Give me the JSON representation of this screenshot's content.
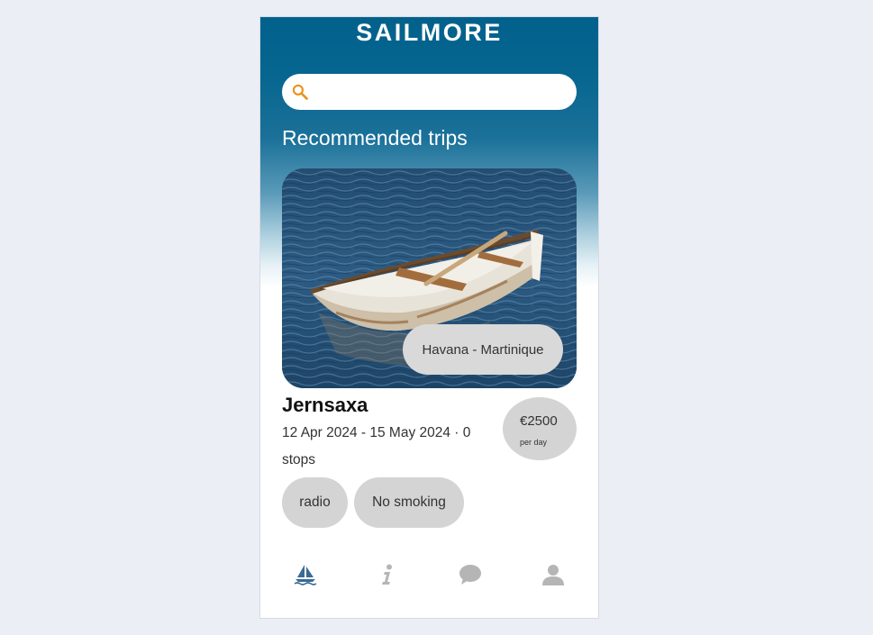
{
  "app": {
    "title": "SAILMORE"
  },
  "search": {
    "placeholder": ""
  },
  "section": {
    "title": "Recommended trips"
  },
  "trip": {
    "route": "Havana - Martinique",
    "name": "Jernsaxa",
    "dates": "12 Apr 2024 - 15 May 2024 · 0 stops",
    "price": "€2500",
    "price_unit": "per day",
    "tags": [
      "radio",
      "No smoking"
    ]
  },
  "nav": {
    "items": [
      {
        "icon": "sailboat-icon",
        "active": true
      },
      {
        "icon": "info-icon",
        "active": false
      },
      {
        "icon": "chat-icon",
        "active": false
      },
      {
        "icon": "user-icon",
        "active": false
      }
    ]
  },
  "colors": {
    "header": "#02618c",
    "search_icon": "#e8931f",
    "nav_active": "#3a6a95",
    "nav_inactive": "#b5b5b5",
    "pill": "#d4d4d4"
  }
}
